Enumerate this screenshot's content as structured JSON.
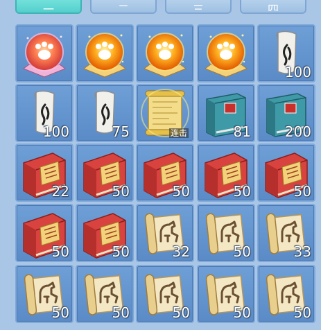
{
  "tabs": [
    {
      "label": "一",
      "active": true
    },
    {
      "label": "二",
      "active": false
    },
    {
      "label": "三",
      "active": false
    },
    {
      "label": "四",
      "active": false
    }
  ],
  "items": [
    {
      "kind": "paw-orb-pink",
      "count": ""
    },
    {
      "kind": "paw-orb",
      "count": ""
    },
    {
      "kind": "paw-orb",
      "count": ""
    },
    {
      "kind": "paw-orb",
      "count": ""
    },
    {
      "kind": "talisman",
      "count": "100"
    },
    {
      "kind": "talisman",
      "count": "100"
    },
    {
      "kind": "talisman",
      "count": "75"
    },
    {
      "kind": "golden-scroll",
      "count": "",
      "tag": "连击"
    },
    {
      "kind": "blue-book",
      "count": "81"
    },
    {
      "kind": "blue-book",
      "count": "200"
    },
    {
      "kind": "red-book",
      "count": "22"
    },
    {
      "kind": "red-book",
      "count": "50"
    },
    {
      "kind": "red-book",
      "count": "50"
    },
    {
      "kind": "red-book",
      "count": "50"
    },
    {
      "kind": "red-book",
      "count": "50"
    },
    {
      "kind": "red-book",
      "count": "50"
    },
    {
      "kind": "red-book",
      "count": "50"
    },
    {
      "kind": "horse-scroll",
      "count": "32"
    },
    {
      "kind": "horse-scroll",
      "count": "50"
    },
    {
      "kind": "horse-scroll",
      "count": "33"
    },
    {
      "kind": "horse-scroll",
      "count": "50"
    },
    {
      "kind": "horse-scroll",
      "count": "50"
    },
    {
      "kind": "horse-scroll",
      "count": "50"
    },
    {
      "kind": "horse-scroll",
      "count": "50"
    },
    {
      "kind": "horse-scroll",
      "count": "50"
    }
  ]
}
